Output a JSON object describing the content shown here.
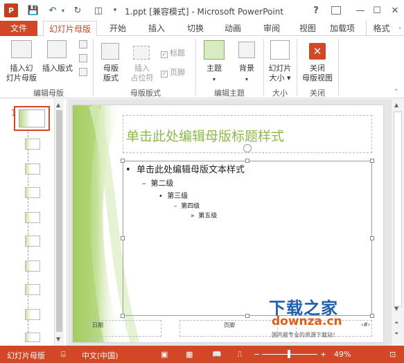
{
  "window": {
    "app_badge": "P",
    "title": "1.ppt [兼容模式] - Microsoft PowerPoint",
    "help": "?",
    "minimize": "—",
    "maximize": "☐",
    "close": "✕"
  },
  "tabs": [
    "文件",
    "幻灯片母版",
    "开始",
    "插入",
    "切换",
    "动画",
    "审阅",
    "视图",
    "加载项",
    "格式"
  ],
  "ribbon": {
    "insert_master": [
      "插入幻",
      "灯片母版"
    ],
    "insert_layout": "插入版式",
    "master_layout": [
      "母版",
      "版式"
    ],
    "insert_placeholder": [
      "插入",
      "占位符"
    ],
    "title_chk": "标题",
    "footer_chk": "页脚",
    "theme": "主题",
    "background": "背景",
    "slide_size": [
      "幻灯片",
      "大小"
    ],
    "close_master": [
      "关闭",
      "母版视图"
    ],
    "groups": {
      "edit_master": "编辑母版",
      "master_layout": "母版版式",
      "edit_theme": "编辑主题",
      "size": "大小",
      "close": "关闭"
    }
  },
  "thumbs": {
    "master_index": "1"
  },
  "slide": {
    "title": "单击此处编辑母版标题样式",
    "level1": "单击此处编辑母版文本样式",
    "level2": "第二级",
    "level3": "第三级",
    "level4": "第四级",
    "level5": "第五级",
    "footer_date": "日期",
    "footer_mid": "页脚",
    "footer_num": "‹#›"
  },
  "watermark": {
    "brand_cn": "下载之家",
    "brand_url": "downza.cn",
    "slogan": "国内最专业的资源下载站！"
  },
  "status": {
    "view_name": "幻灯片母版",
    "language": "中文(中国)",
    "zoom": "49%",
    "zoom_fraction": 0.49
  }
}
